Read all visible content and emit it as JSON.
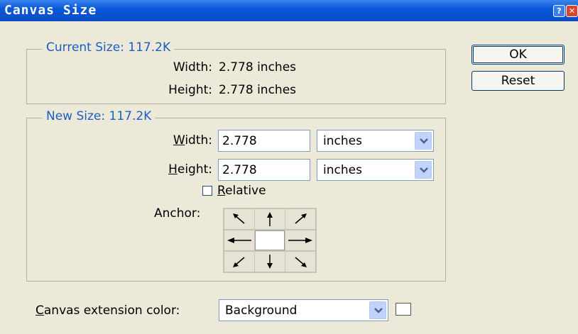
{
  "window": {
    "title": "Canvas Size"
  },
  "current_size": {
    "legend": "Current Size: 117.2K",
    "width_label": "Width:",
    "width_value": "2.778 inches",
    "height_label": "Height:",
    "height_value": "2.778 inches"
  },
  "new_size": {
    "legend": "New Size: 117.2K",
    "width_label_mnemonic": "W",
    "width_label_rest": "idth:",
    "width_value": "2.778",
    "width_unit": "inches",
    "height_label_mnemonic": "H",
    "height_label_rest": "eight:",
    "height_value": "2.778",
    "height_unit": "inches",
    "relative_mnemonic": "R",
    "relative_rest": "elative",
    "relative_checked": false,
    "anchor_label": "Anchor:",
    "anchor_cells": [
      "arrow-up-left-icon",
      "arrow-up-icon",
      "arrow-up-right-icon",
      "arrow-left-icon",
      "anchor-center",
      "arrow-right-icon",
      "arrow-down-left-icon",
      "arrow-down-icon",
      "arrow-down-right-icon"
    ]
  },
  "buttons": {
    "ok": "OK",
    "reset": "Reset"
  },
  "extension": {
    "label_mnemonic": "C",
    "label_rest": "anvas extension color:",
    "value": "Background",
    "swatch_color": "#ffffff"
  },
  "colors": {
    "titlebar": "#0a58d8",
    "dialog_bg": "#ece9d8",
    "legend_text": "#1a5fc4"
  }
}
